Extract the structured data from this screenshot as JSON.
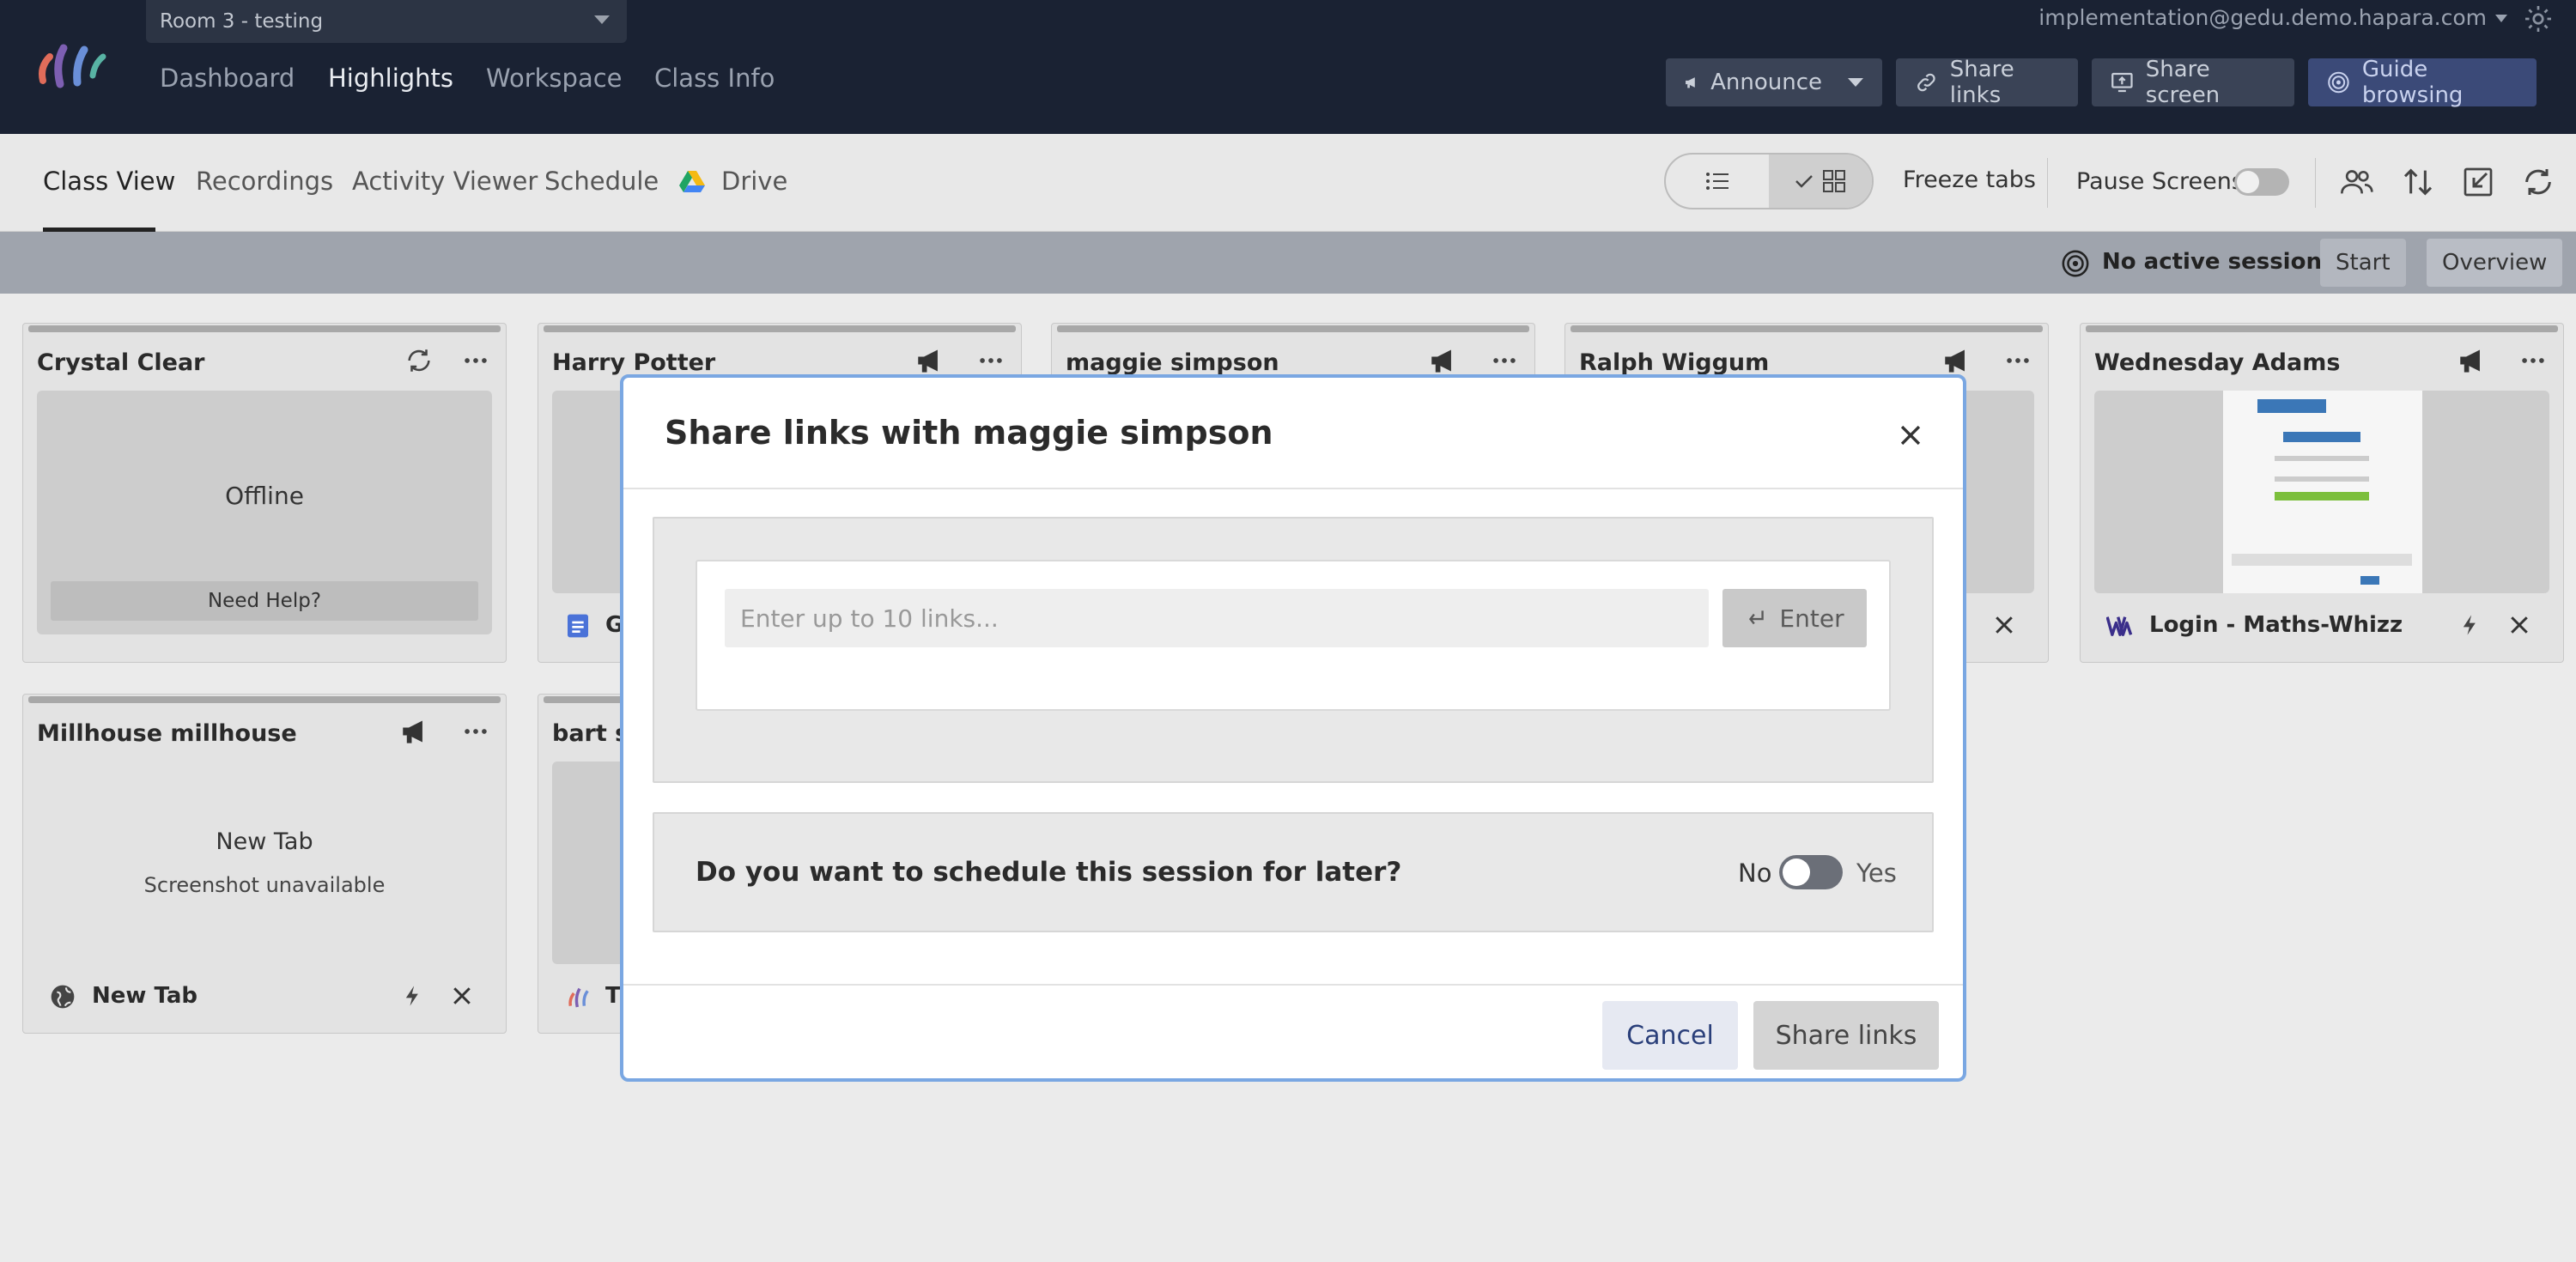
{
  "topnav": {
    "room": "Room 3 - testing",
    "links": [
      "Dashboard",
      "Highlights",
      "Workspace",
      "Class Info"
    ],
    "active": "Highlights",
    "user_email": "implementation@gedu.demo.hapara.com",
    "buttons": {
      "announce": "Announce",
      "share_links": "Share links",
      "share_screen": "Share screen",
      "guide_browsing": "Guide browsing"
    }
  },
  "subnav": {
    "tabs": [
      "Class View",
      "Recordings",
      "Activity Viewer",
      "Schedule",
      "Drive"
    ],
    "freeze": "Freeze tabs",
    "pause": "Pause Screens"
  },
  "sessions": {
    "status": "No active sessions",
    "start": "Start",
    "overview": "Overview"
  },
  "cards": [
    {
      "name": "Crystal Clear",
      "status": "Offline",
      "help": "Need Help?"
    },
    {
      "name": "Harry Potter",
      "footer": "G"
    },
    {
      "name": "maggie simpson"
    },
    {
      "name": "Ralph Wiggum"
    },
    {
      "name": "Wednesday Adams",
      "footer": "Login - Maths-Whizz"
    },
    {
      "name": "Millhouse millhouse",
      "tab": "New Tab",
      "note": "Screenshot unavailable",
      "footer": "New Tab"
    },
    {
      "name": "bart si",
      "footer": "T"
    }
  ],
  "modal": {
    "title": "Share links with maggie simpson",
    "input_placeholder": "Enter up to 10 links...",
    "enter": "Enter",
    "schedule_question": "Do you want to schedule this session for later?",
    "no": "No",
    "yes": "Yes",
    "cancel": "Cancel",
    "share": "Share links"
  },
  "colors": {
    "nav_bg": "#1a2233",
    "modal_border": "#7aa7e2",
    "cancel_text": "#2a3f7a"
  }
}
